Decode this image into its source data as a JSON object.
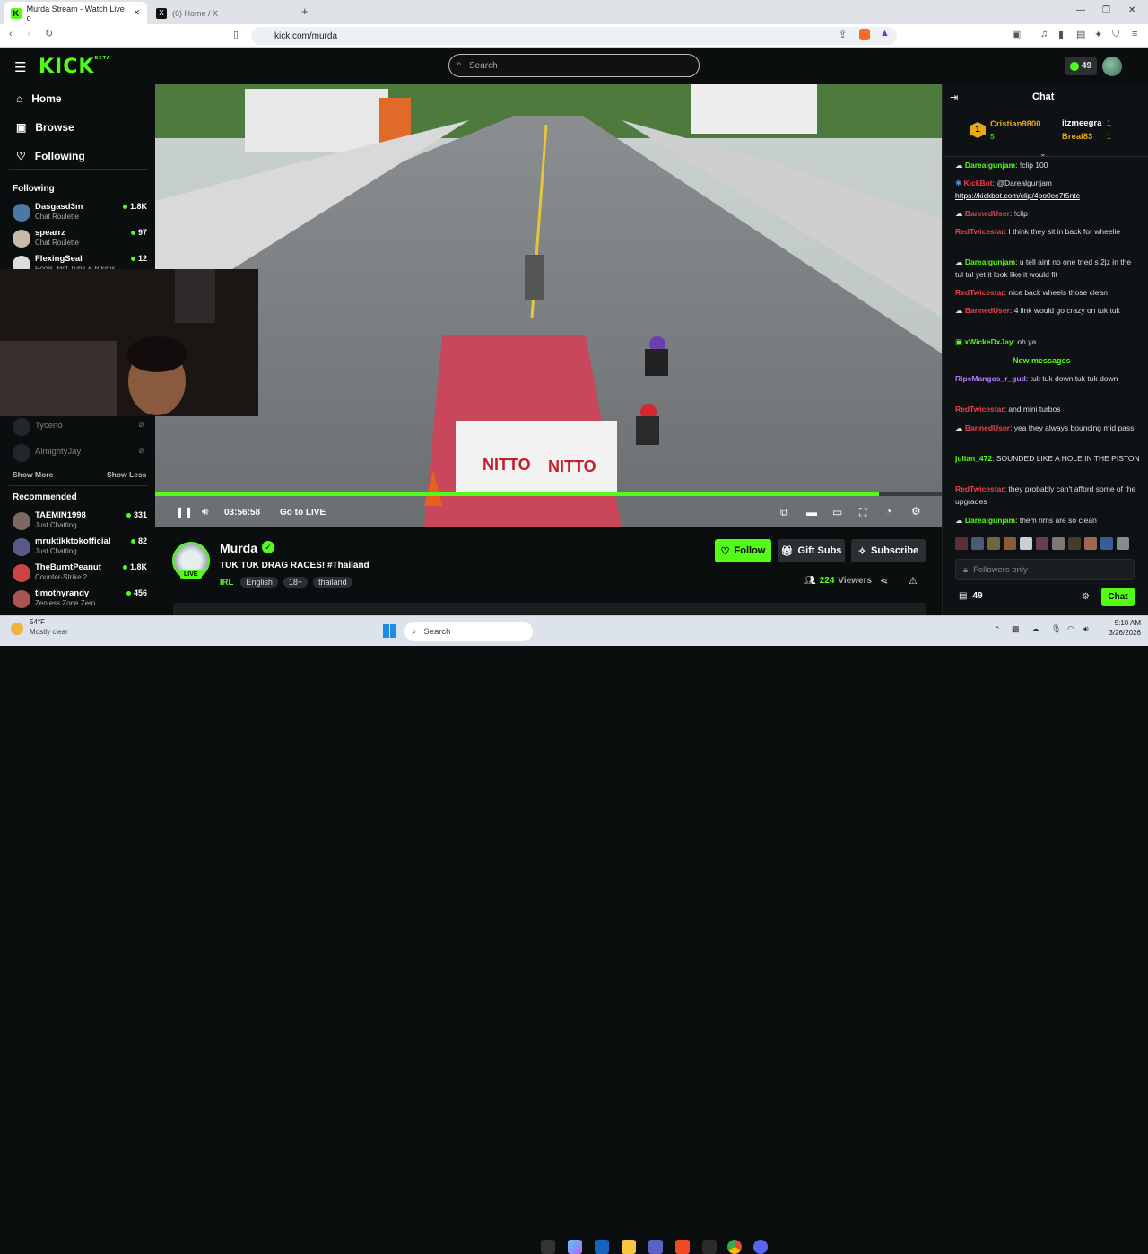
{
  "browser": {
    "tabs": [
      {
        "label": "Murda Stream - Watch Live o"
      },
      {
        "label": "(6) Home / X"
      }
    ],
    "url": "kick.com/murda",
    "new_tab": "+",
    "window_controls": {
      "minimize": "—",
      "maximize": "❐",
      "close": "✕"
    }
  },
  "topnav": {
    "logo": "KICK",
    "beta": "BETA",
    "search_placeholder": "Search",
    "kicks": "49"
  },
  "sidebar": {
    "nav": [
      {
        "label": "Home",
        "icon": "home-icon"
      },
      {
        "label": "Browse",
        "icon": "browse-icon"
      },
      {
        "label": "Following",
        "icon": "heart-icon"
      }
    ],
    "following_title": "Following",
    "following": [
      {
        "name": "Dasgasd3m",
        "category": "Chat Roulette",
        "viewers": "1.8K"
      },
      {
        "name": "spearrz",
        "category": "Chat Roulette",
        "viewers": "97"
      },
      {
        "name": "FlexingSeal",
        "category": "Pools, Hot Tubs & Bikinis",
        "viewers": "12"
      }
    ],
    "offline": [
      {
        "name": "Tyceno"
      },
      {
        "name": "AlmightyJay"
      }
    ],
    "show_more": "Show More",
    "show_less": "Show Less",
    "recommended_title": "Recommended",
    "recommended": [
      {
        "name": "TAEMIN1998",
        "category": "Just Chatting",
        "viewers": "331"
      },
      {
        "name": "mruktikktokofficial",
        "category": "Just Chatting",
        "viewers": "82"
      },
      {
        "name": "TheBurntPeanut",
        "category": "Counter-Strike 2",
        "viewers": "1.8K"
      },
      {
        "name": "timothyrandy",
        "category": "Zenless Zone Zero",
        "viewers": "456"
      }
    ]
  },
  "player": {
    "timestamp": "03:56:58",
    "go_live": "Go to LIVE",
    "progress": 0.92,
    "banner_text": [
      "NITTO",
      "NITTO"
    ]
  },
  "stream": {
    "channel": "Murda",
    "live": "LIVE",
    "title": "TUK TUK DRAG RACES!  #Thailand",
    "category": "IRL",
    "tags": [
      "English",
      "18+",
      "thailand"
    ],
    "viewers": "224",
    "viewers_label": "Viewers",
    "follow": "Follow",
    "gift": "Gift Subs",
    "subscribe": "Subscribe"
  },
  "chat": {
    "title": "Chat",
    "leaderboard": [
      {
        "rank": "1",
        "name": "Cristian9800",
        "count": "5"
      },
      {
        "name": "itzmeegra",
        "count": "1"
      },
      {
        "name": "Breal83",
        "count": "1"
      }
    ],
    "messages": [
      {
        "user": "Darealgunjam",
        "color": "g",
        "text": "!clip 100"
      },
      {
        "user": "KickBot",
        "color": "r",
        "text": "@Darealgunjam",
        "link": "https://kickbot.com/clip/4po0ce7t5ntc"
      },
      {
        "user": "BannedUser",
        "color": "r",
        "text": "!clip"
      },
      {
        "user": "RedTwicestar",
        "color": "r",
        "text": "I think they sit in back for wheelie"
      },
      {
        "user": "Darealgunjam",
        "color": "g",
        "text": "u tell aint no one tried s 2jz in the tul tul yet it look like it would fit"
      },
      {
        "user": "RedTwicestar",
        "color": "r",
        "text": "nice back wheels those clean"
      },
      {
        "user": "BannedUser",
        "color": "r",
        "text": "4 link would go crazy on tuk tuk"
      },
      {
        "user": "xWickeDxJay",
        "color": "g",
        "text": "oh ya"
      }
    ],
    "new_messages": "New messages",
    "messages2": [
      {
        "user": "RipeMangos_r_gud",
        "color": "p",
        "text": "tuk tuk down     tuk tuk down"
      },
      {
        "user": "RedTwicestar",
        "color": "r",
        "text": "and mini turbos"
      },
      {
        "user": "BannedUser",
        "color": "r",
        "text": "yea they always bouncing mid pass"
      },
      {
        "user": "julian_472",
        "color": "g",
        "text": "SOUNDED LIKE A HOLE IN THE PISTON"
      },
      {
        "user": "RedTwicestar",
        "color": "r",
        "text": "they probably can't afford some of the upgrades"
      },
      {
        "user": "Darealgunjam",
        "color": "g",
        "text": "them rims are so clean"
      }
    ],
    "input_placeholder": "Followers only",
    "points": "49",
    "send": "Chat"
  },
  "taskbar": {
    "weather_temp": "54°F",
    "weather_desc": "Mostly clear",
    "search": "Search",
    "time": "5:10 AM",
    "date": "3/26/2026"
  },
  "colors": {
    "accent": "#53fc18",
    "bg": "#0b0e0f",
    "chat_red": "#e8424d",
    "chat_purple": "#b57cff"
  }
}
